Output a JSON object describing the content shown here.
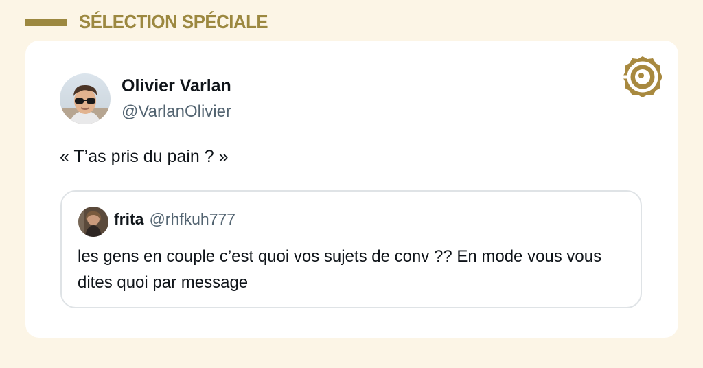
{
  "header": {
    "title": "SÉLECTION SPÉCIALE",
    "accent_color": "#9c8840"
  },
  "tweet": {
    "author": {
      "name": "Olivier Varlan",
      "handle": "@VarlanOlivier"
    },
    "text": "« T’as pris du pain ? »",
    "quoted": {
      "author": {
        "name": "frita",
        "handle": "@rhfkuh777"
      },
      "text": "les gens en couple c’est quoi vos sujets de conv ?? En mode vous vous dites quoi par message"
    }
  },
  "icons": {
    "brand_logo": "brand-logo-icon",
    "avatar": "avatar",
    "quote_avatar": "avatar"
  },
  "colors": {
    "background": "#fcf5e6",
    "card": "#ffffff",
    "text": "#0f1419",
    "muted": "#536471",
    "border": "#dfe3e6"
  }
}
